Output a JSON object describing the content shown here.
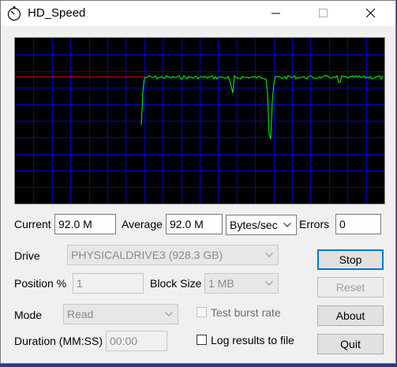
{
  "window": {
    "title": "HD_Speed"
  },
  "stats": {
    "current_label": "Current",
    "current_value": "92.0 M",
    "average_label": "Average",
    "average_value": "92.0 M",
    "units": "Bytes/sec",
    "errors_label": "Errors",
    "errors_value": "0"
  },
  "settings": {
    "drive_label": "Drive",
    "drive_value": "PHYSICALDRIVE3 (928.3 GB)",
    "position_label": "Position %",
    "position_value": "1",
    "blocksize_label": "Block Size",
    "blocksize_value": "1 MB",
    "mode_label": "Mode",
    "mode_value": "Read",
    "burst_label": "Test burst rate",
    "duration_label": "Duration (MM:SS)",
    "duration_value": "00:00",
    "log_label": "Log results to file"
  },
  "buttons": {
    "stop": "Stop",
    "reset": "Reset",
    "about": "About",
    "quit": "Quit"
  },
  "colors": {
    "grid": "#0000c8",
    "trace": "#00e000",
    "reference": "#d00000",
    "background": "#000000"
  }
}
